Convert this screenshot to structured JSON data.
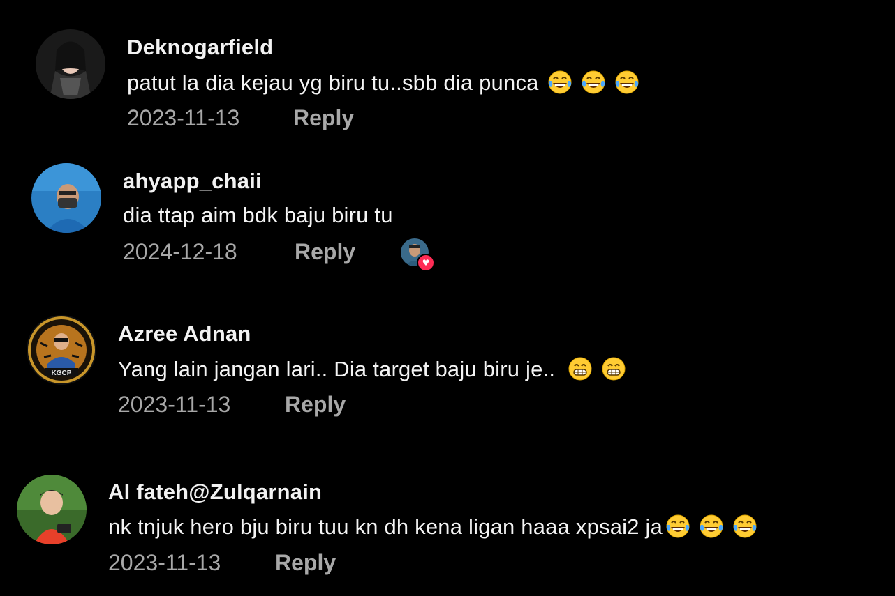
{
  "comments": [
    {
      "username": "Deknogarfield",
      "text": "patut la dia kejau yg biru tu..sbb dia punca",
      "emojis": [
        "tears-of-joy",
        "tears-of-joy",
        "tears-of-joy"
      ],
      "date": "2023-11-13",
      "reply_label": "Reply"
    },
    {
      "username": "ahyapp_chaii",
      "text": "dia ttap aim bdk baju biru tu",
      "emojis": [],
      "date": "2024-12-18",
      "reply_label": "Reply",
      "liked_by_creator": true
    },
    {
      "username": "Azree Adnan",
      "text": "Yang lain jangan lari.. Dia target baju biru je..",
      "emojis": [
        "grinning-face",
        "grinning-face"
      ],
      "date": "2023-11-13",
      "reply_label": "Reply"
    },
    {
      "username": "Al fateh@Zulqarnain",
      "text": "nk tnjuk hero bju biru tuu kn dh kena ligan haaa xpsai2 ja",
      "emojis": [
        "tears-of-joy",
        "tears-of-joy",
        "tears-of-joy"
      ],
      "date": "2023-11-13",
      "reply_label": "Reply"
    }
  ],
  "colors": {
    "background": "#000000",
    "username": "#f2f2f2",
    "text": "#f4f4f4",
    "meta": "#a8a8a8",
    "heart": "#fe2c55"
  }
}
